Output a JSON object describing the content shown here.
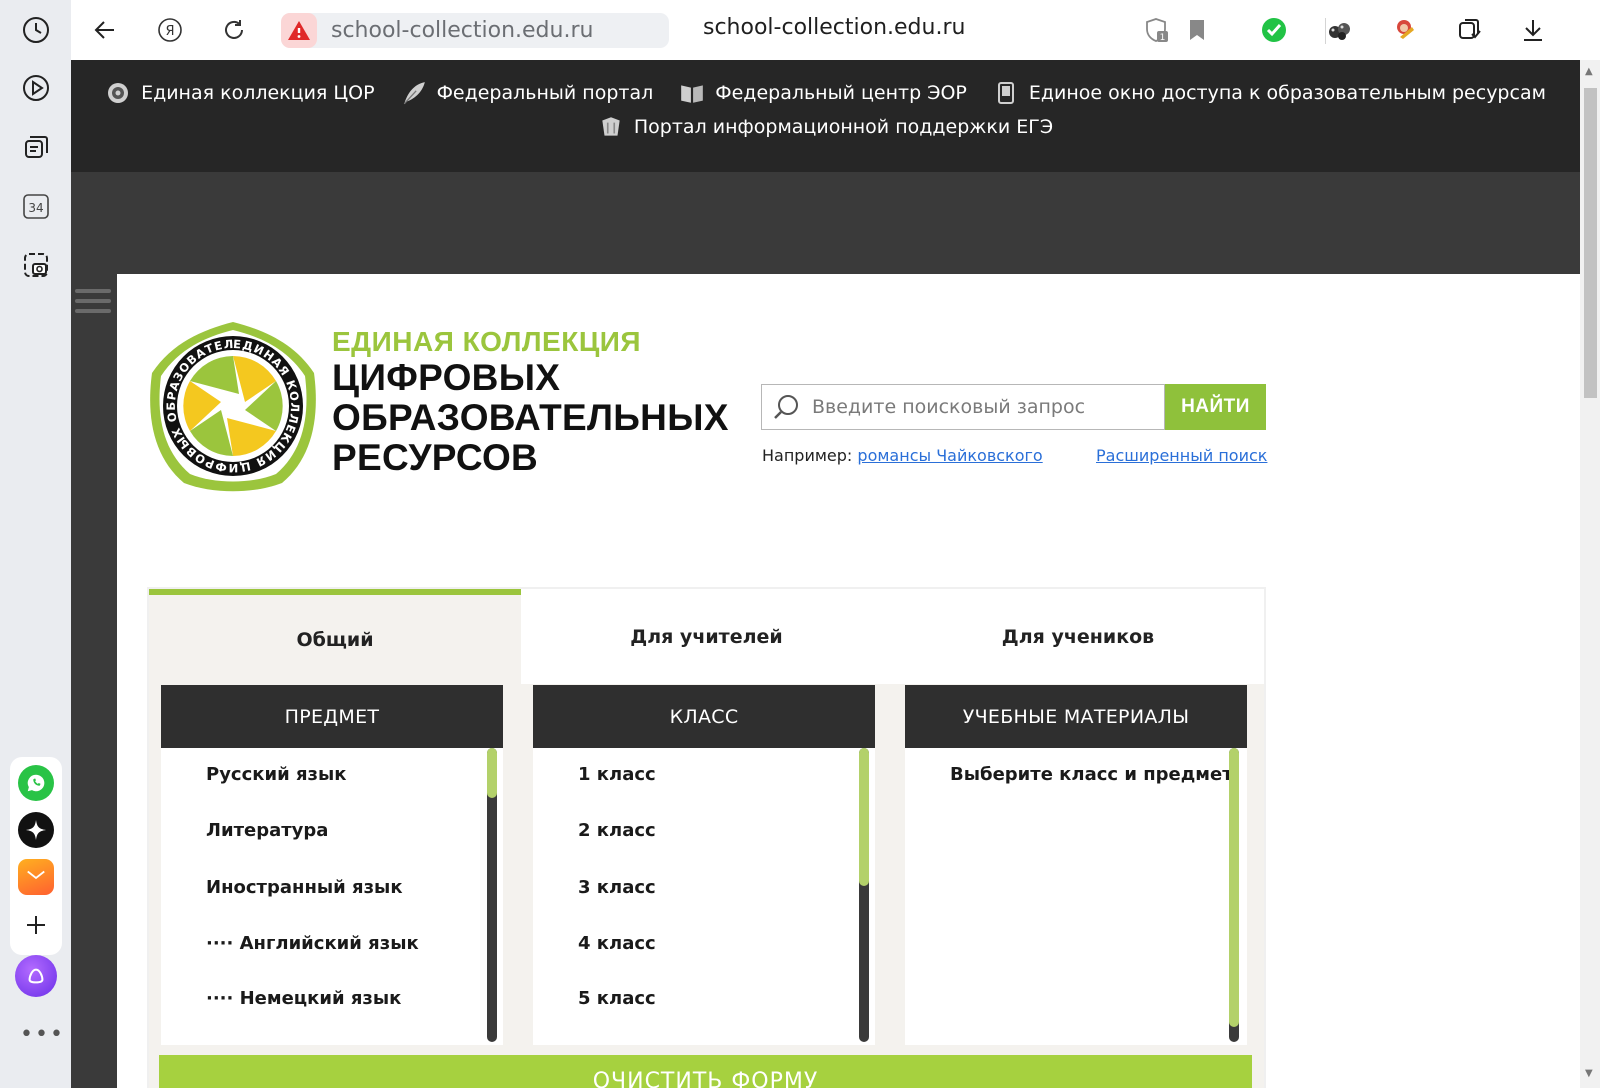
{
  "browser": {
    "url": "school-collection.edu.ru",
    "title": "school-collection.edu.ru",
    "shield_badge": "1",
    "side_badge": "34"
  },
  "top_nav": {
    "row1": [
      {
        "label": "Единая коллекция ЦОР",
        "icon": "disc-icon"
      },
      {
        "label": "Федеральный портал",
        "icon": "feather-icon"
      },
      {
        "label": "Федеральный центр ЭОР",
        "icon": "book-icon"
      },
      {
        "label": "Единое окно доступа к образовательным ресурсам",
        "icon": "window-icon"
      }
    ],
    "row2": [
      {
        "label": "Портал информационной поддержки ЕГЭ",
        "icon": "graduation-icon"
      }
    ]
  },
  "logo": {
    "line1": "ЕДИНАЯ КОЛЛЕКЦИЯ",
    "line2": "ЦИФРОВЫХ",
    "line3": "ОБРАЗОВАТЕЛЬНЫХ",
    "line4": "РЕСУРСОВ"
  },
  "search": {
    "placeholder": "Введите поисковый запрос",
    "button": "НАЙТИ",
    "example_prefix": "Например:",
    "example_link": "романсы Чайковского",
    "advanced": "Расширенный поиск"
  },
  "tabs": [
    {
      "label": "Общий",
      "active": true
    },
    {
      "label": "Для учителей",
      "active": false
    },
    {
      "label": "Для учеников",
      "active": false
    }
  ],
  "columns": {
    "subject": {
      "header": "ПРЕДМЕТ",
      "items": [
        "Русский язык",
        "Литература",
        "Иностранный язык",
        "···· Английский язык",
        "···· Немецкий язык"
      ],
      "scroll_fraction": 0.17
    },
    "grade": {
      "header": "КЛАСС",
      "items": [
        "1 класс",
        "2 класс",
        "3 класс",
        "4 класс",
        "5 класс"
      ],
      "scroll_fraction": 0.47
    },
    "materials": {
      "header": "УЧЕБНЫЕ МАТЕРИАЛЫ",
      "items": [
        "Выберите класс и предмет"
      ],
      "scroll_fraction": 0.95
    }
  },
  "clear_button": "ОЧИСТИТЬ ФОРМУ",
  "colors": {
    "accent_green": "#9bc53d",
    "nav_dark": "#262626",
    "header_dark": "#2f2f2f"
  }
}
